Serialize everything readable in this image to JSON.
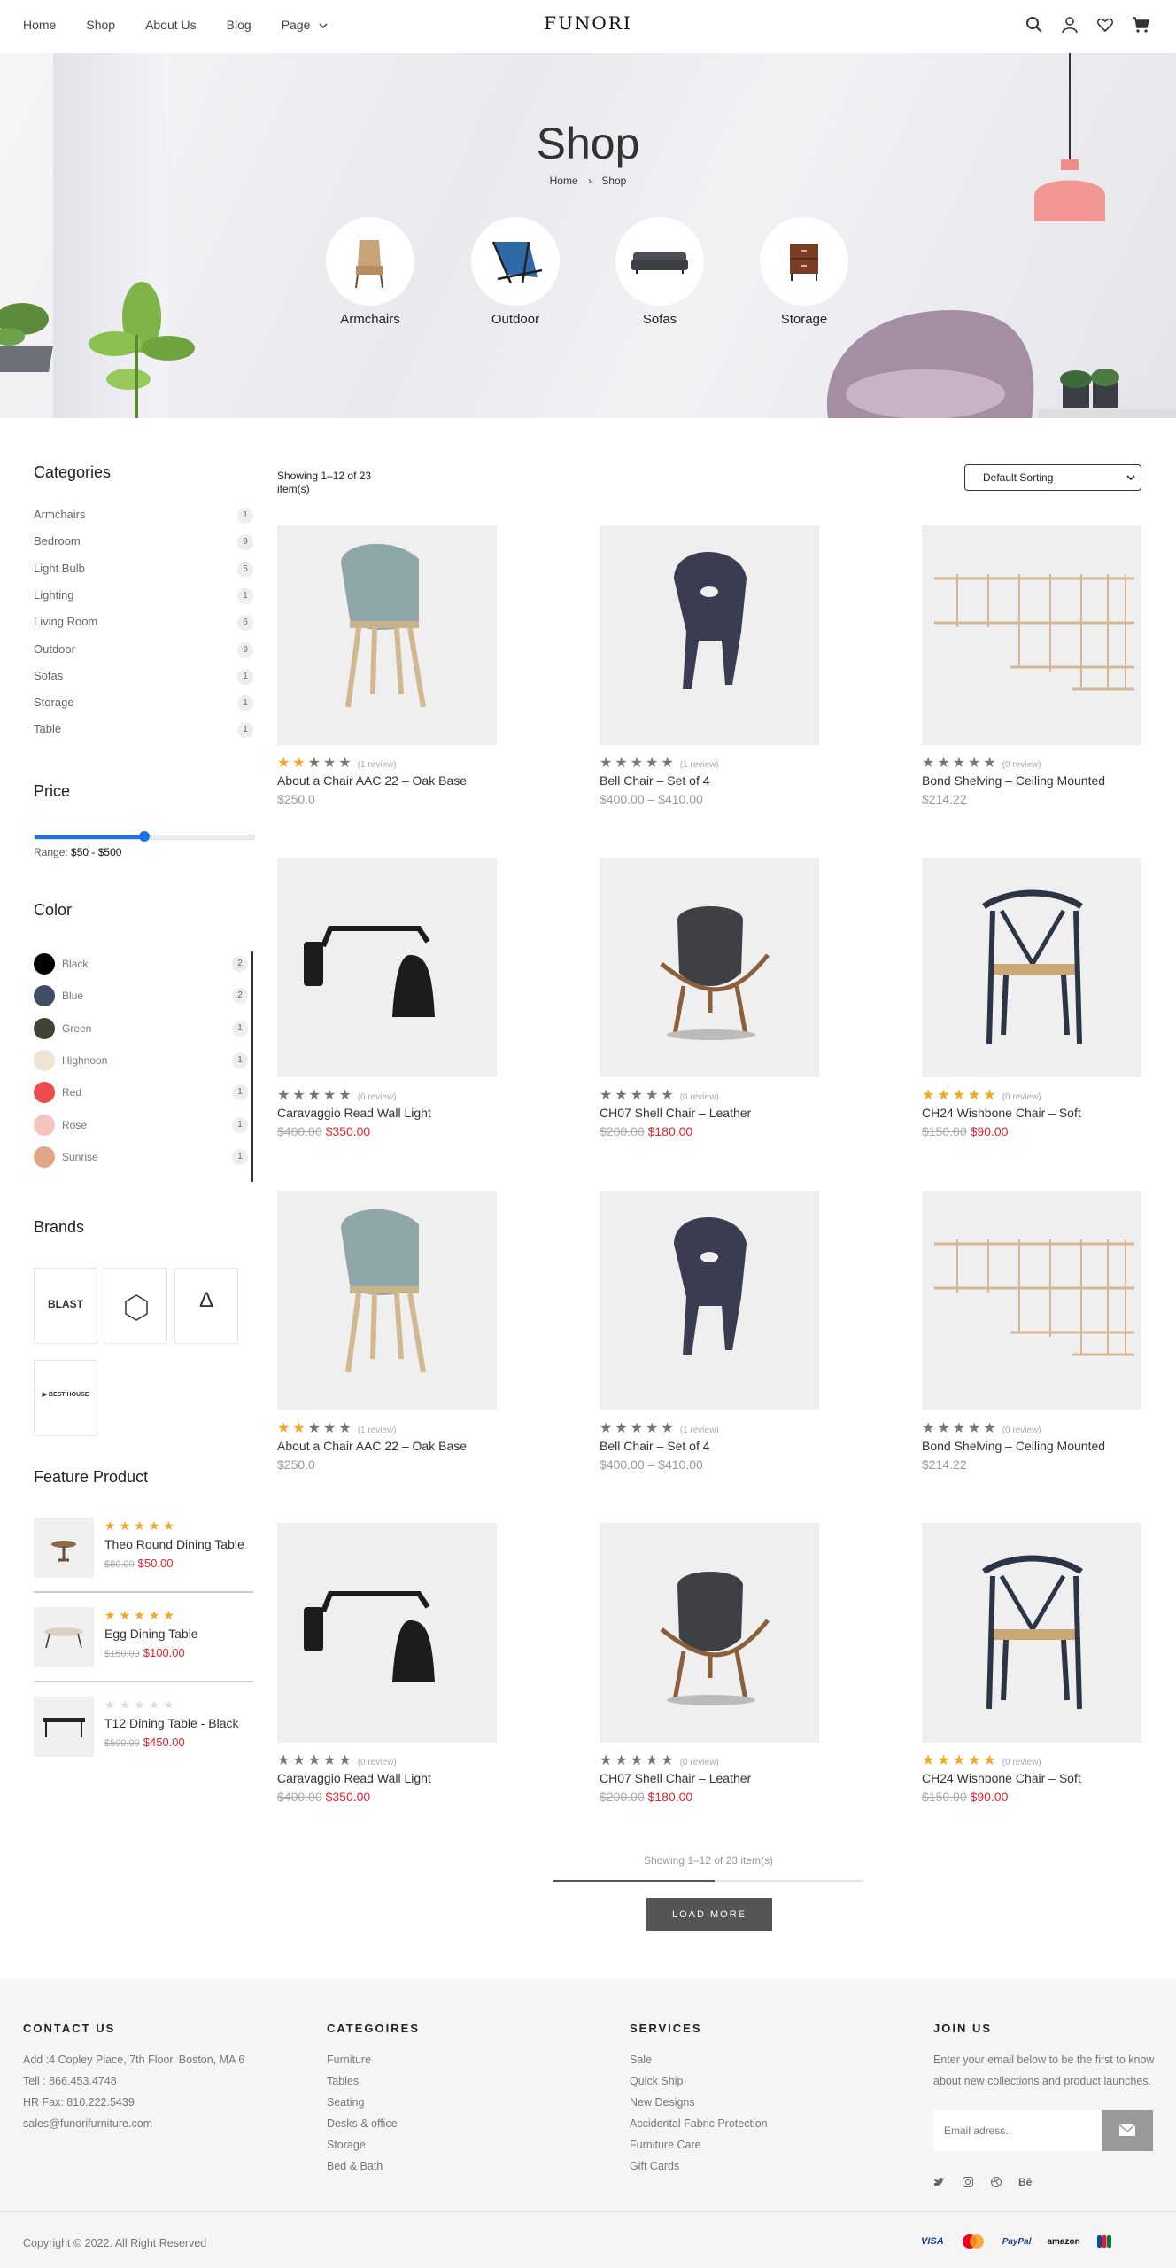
{
  "nav": {
    "home": "Home",
    "shop": "Shop",
    "about": "About Us",
    "blog": "Blog",
    "page": "Page"
  },
  "logo": "FUNORI",
  "hero": {
    "title": "Shop",
    "crumb_home": "Home",
    "crumb_current": "Shop",
    "categories": [
      "Armchairs",
      "Outdoor",
      "Sofas",
      "Storage"
    ]
  },
  "sidebar": {
    "categories_title": "Categories",
    "categories": [
      {
        "name": "Armchairs",
        "count": "1"
      },
      {
        "name": "Bedroom",
        "count": "9"
      },
      {
        "name": "Light Bulb",
        "count": "5"
      },
      {
        "name": "Lighting",
        "count": "1"
      },
      {
        "name": "Living Room",
        "count": "6"
      },
      {
        "name": "Outdoor",
        "count": "9"
      },
      {
        "name": "Sofas",
        "count": "1"
      },
      {
        "name": "Storage",
        "count": "1"
      },
      {
        "name": "Table",
        "count": "1"
      }
    ],
    "price_title": "Price",
    "range_label": "Range:",
    "range_value": "$50 - $500",
    "range_fraction": 0.5,
    "color_title": "Color",
    "colors": [
      {
        "name": "Black",
        "count": "2",
        "hex": "#000000"
      },
      {
        "name": "Blue",
        "count": "2",
        "hex": "#3f4d66"
      },
      {
        "name": "Green",
        "count": "1",
        "hex": "#3f4436"
      },
      {
        "name": "Highnoon",
        "count": "1",
        "hex": "#efe3d3"
      },
      {
        "name": "Red",
        "count": "1",
        "hex": "#ee4d50"
      },
      {
        "name": "Rose",
        "count": "1",
        "hex": "#f7c3bf"
      },
      {
        "name": "Sunrise",
        "count": "1",
        "hex": "#e0a689"
      }
    ],
    "brands_title": "Brands",
    "brands": [
      "BLAST",
      "BRAND",
      "Δ",
      "BEST HOUSE"
    ],
    "feature_title": "Feature Product",
    "features": [
      {
        "name": "Theo Round Dining Table",
        "old": "$80.00",
        "price": "$50.00",
        "stars": 5
      },
      {
        "name": "Egg Dining Table",
        "old": "$150.00",
        "price": "$100.00",
        "stars": 5
      },
      {
        "name": "T12 Dining Table - Black",
        "old": "$500.00",
        "price": "$450.00",
        "stars": 0
      }
    ]
  },
  "toolbar": {
    "showing": "Showing 1–12 of 23 item(s)",
    "sort": "Default Sorting"
  },
  "products": [
    {
      "name": "About a Chair AAC 22 – Oak Base",
      "price": "$250.0",
      "old": "",
      "stars": 2,
      "reviews": "(1 review)"
    },
    {
      "name": "Bell Chair – Set of 4",
      "price": "$400.00 – $410.00",
      "old": "",
      "stars": 0,
      "reviews": "(1 review)"
    },
    {
      "name": "Bond Shelving – Ceiling Mounted",
      "price": "$214.22",
      "old": "",
      "stars": 0,
      "reviews": "(0 review)"
    },
    {
      "name": "Caravaggio Read Wall Light",
      "price": "$350.00",
      "old": "$400.00",
      "stars": 0,
      "reviews": "(0 review)"
    },
    {
      "name": "CH07 Shell Chair – Leather",
      "price": "$180.00",
      "old": "$200.00",
      "stars": 0,
      "reviews": "(0 review)"
    },
    {
      "name": "CH24 Wishbone Chair – Soft",
      "price": "$90.00",
      "old": "$150.00",
      "stars": 5,
      "reviews": "(0 review)"
    },
    {
      "name": "About a Chair AAC 22 – Oak Base",
      "price": "$250.0",
      "old": "",
      "stars": 2,
      "reviews": "(1 review)"
    },
    {
      "name": "Bell Chair – Set of 4",
      "price": "$400.00 – $410.00",
      "old": "",
      "stars": 0,
      "reviews": "(1 review)"
    },
    {
      "name": "Bond Shelving – Ceiling Mounted",
      "price": "$214.22",
      "old": "",
      "stars": 0,
      "reviews": "(0 review)"
    },
    {
      "name": "Caravaggio Read Wall Light",
      "price": "$350.00",
      "old": "$400.00",
      "stars": 0,
      "reviews": "(0 review)"
    },
    {
      "name": "CH07 Shell Chair – Leather",
      "price": "$180.00",
      "old": "$200.00",
      "stars": 0,
      "reviews": "(0 review)"
    },
    {
      "name": "CH24 Wishbone Chair – Soft",
      "price": "$90.00",
      "old": "$150.00",
      "stars": 5,
      "reviews": "(0 review)"
    }
  ],
  "pagination": {
    "showing": "Showing 1–12 of 23 item(s)",
    "load_more": "LOAD MORE",
    "progress": 0.52
  },
  "footer": {
    "contact_title": "CONTACT US",
    "contact": [
      "Add :4 Copley Place, 7th Floor, Boston, MA 6",
      "Tell : 866.453.4748",
      "HR Fax: 810.222.5439",
      "sales@funorifurniture.com"
    ],
    "categories_title": "CATEGOIRES",
    "categories": [
      "Furniture",
      "Tables",
      "Seating",
      "Desks & office",
      "Storage",
      "Bed & Bath"
    ],
    "services_title": "SERVICES",
    "services": [
      "Sale",
      "Quick Ship",
      "New Designs",
      "Accidental Fabric Protection",
      "Furniture Care",
      "Gift Cards"
    ],
    "join_title": "JOIN US",
    "join_text_1": "Enter your email below to be the first to know",
    "join_text_2": "about new collections and product launches.",
    "email_placeholder": "Email adress..",
    "social": [
      "twitter-icon",
      "instagram-icon",
      "dribbble-icon",
      "behance-icon"
    ],
    "behance": "Bē",
    "copyright": "Copyright © 2022. All Right Reserved",
    "payments": [
      "VISA",
      "mastercard",
      "PayPal",
      "amazon",
      "jcb"
    ]
  },
  "colors": {
    "accent": "#e3242b",
    "star": "#f5a623",
    "star_off": "#777777",
    "slider": "#1a73e8"
  }
}
